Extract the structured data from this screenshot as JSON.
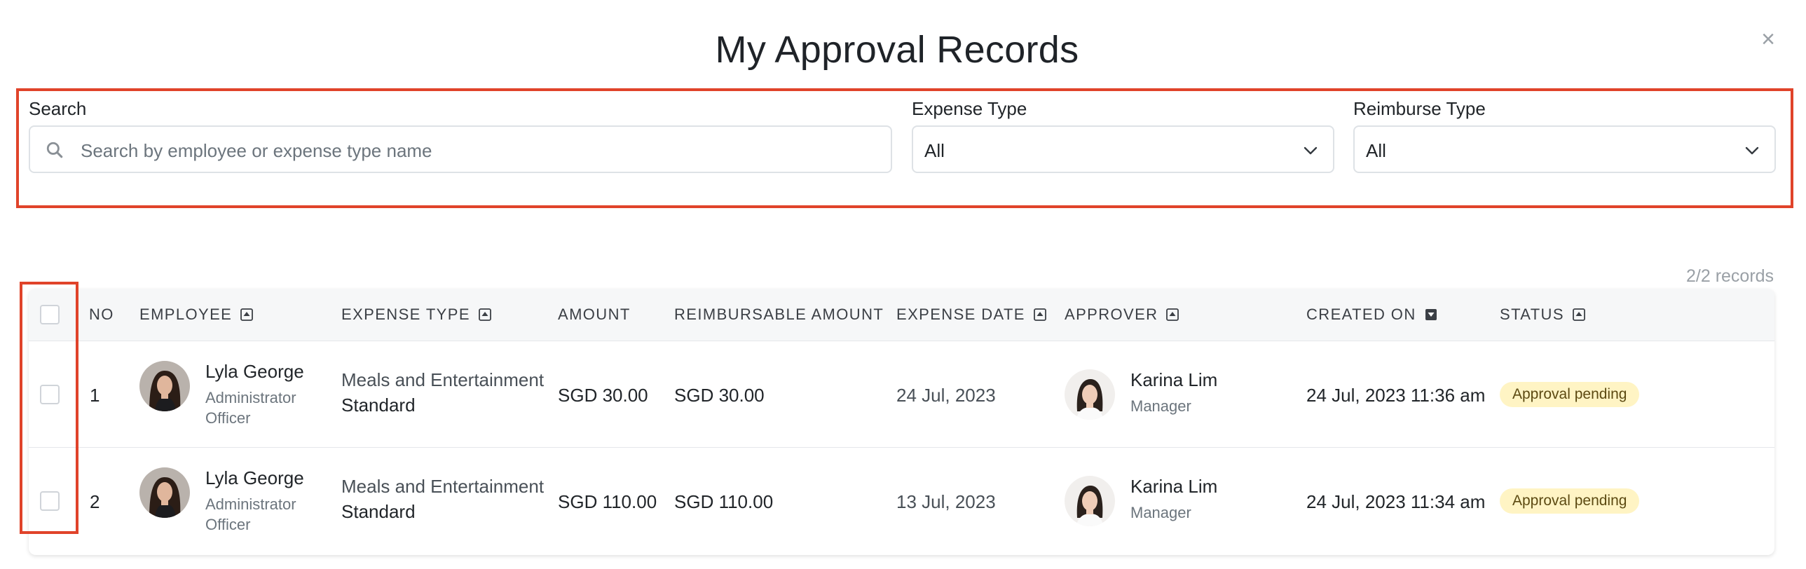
{
  "modal": {
    "title": "My Approval Records",
    "close_icon": "close-icon"
  },
  "filters": {
    "search_label": "Search",
    "search_placeholder": "Search by employee or expense type name",
    "expense_type_label": "Expense Type",
    "expense_type_value": "All",
    "reimburse_type_label": "Reimburse Type",
    "reimburse_type_value": "All"
  },
  "records_count": "2/2 records",
  "table": {
    "headers": {
      "no": "NO",
      "employee": "EMPLOYEE",
      "expense_type": "EXPENSE TYPE",
      "amount": "AMOUNT",
      "reimbursable_amount": "REIMBURSABLE AMOUNT",
      "expense_date": "EXPENSE DATE",
      "approver": "APPROVER",
      "created_on": "CREATED ON",
      "status": "STATUS"
    },
    "rows": [
      {
        "no": "1",
        "employee_name": "Lyla George",
        "employee_role_1": "Administrator",
        "employee_role_2": "Officer",
        "expense_type": "Meals and Entertainment",
        "expense_subtype": "Standard",
        "amount": "SGD 30.00",
        "reimbursable_amount": "SGD 30.00",
        "expense_date": "24 Jul, 2023",
        "approver_name": "Karina Lim",
        "approver_role": "Manager",
        "created_on": "24 Jul, 2023 11:36 am",
        "status": "Approval pending"
      },
      {
        "no": "2",
        "employee_name": "Lyla George",
        "employee_role_1": "Administrator",
        "employee_role_2": "Officer",
        "expense_type": "Meals and Entertainment",
        "expense_subtype": "Standard",
        "amount": "SGD 110.00",
        "reimbursable_amount": "SGD 110.00",
        "expense_date": "13 Jul, 2023",
        "approver_name": "Karina Lim",
        "approver_role": "Manager",
        "created_on": "24 Jul, 2023 11:34 am",
        "status": "Approval pending"
      }
    ]
  },
  "colors": {
    "highlight": "#e0432a",
    "badge_bg": "#fff4c4",
    "header_bg": "#f6f7f8"
  }
}
